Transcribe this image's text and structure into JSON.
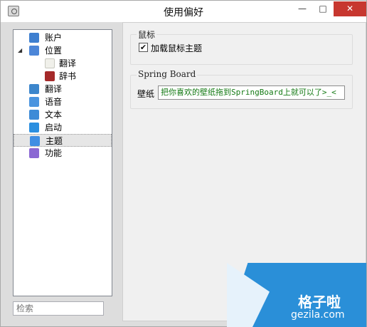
{
  "window": {
    "title": "使用偏好",
    "controls": {
      "minimize": "—",
      "maximize": "□",
      "close": "✕"
    }
  },
  "sidebar": {
    "items": [
      {
        "label": "账户",
        "icon": "user-icon"
      },
      {
        "label": "位置",
        "icon": "location-icon",
        "expanded": true
      },
      {
        "label": "翻译",
        "icon": "note-icon"
      },
      {
        "label": "辞书",
        "icon": "book-icon"
      },
      {
        "label": "翻译",
        "icon": "globe-icon"
      },
      {
        "label": "语音",
        "icon": "music-icon"
      },
      {
        "label": "文本",
        "icon": "document-icon"
      },
      {
        "label": "启动",
        "icon": "app-store-icon"
      },
      {
        "label": "主题",
        "icon": "theme-icon",
        "selected": true
      },
      {
        "label": "功能",
        "icon": "gear-icon"
      }
    ],
    "expander_symbol": "◢"
  },
  "search": {
    "placeholder": "检索"
  },
  "main": {
    "mouse_group": {
      "title": "鼠标",
      "checkbox_label": "加载鼠标主题",
      "checked": true,
      "check_glyph": "✔"
    },
    "springboard_group": {
      "title": "Spring Board",
      "field_label": "壁纸",
      "field_value": "把你喜欢的壁纸拖到SpringBoard上就可以了>_<"
    }
  },
  "watermark": {
    "text_cn": "格子啦",
    "text_en": "gezila.com"
  },
  "colors": {
    "watermark_blue": "#2a8fd8",
    "close_red": "#c7372f",
    "input_text_green": "#147a14"
  }
}
